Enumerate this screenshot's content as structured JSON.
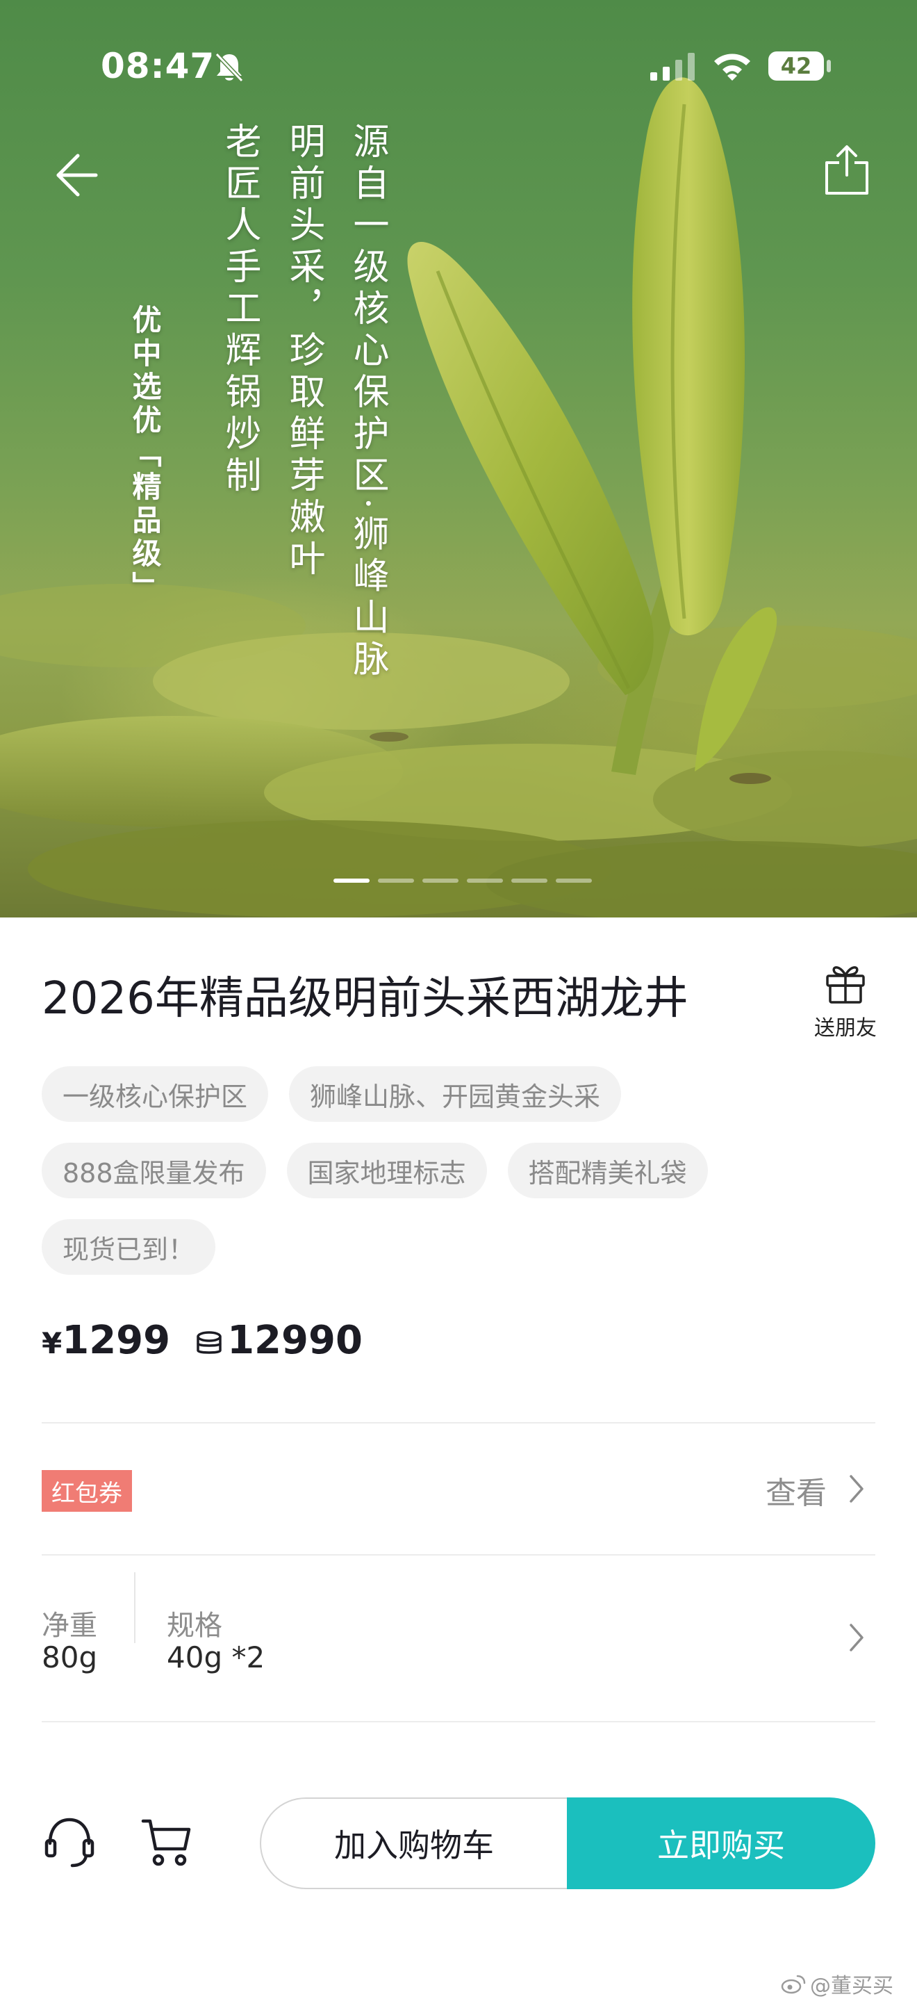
{
  "status_bar": {
    "time": "08:47",
    "battery": "42",
    "icons": [
      "bell-slash-icon",
      "signal-icon",
      "wifi-icon",
      "battery-icon"
    ]
  },
  "hero": {
    "lines": [
      "源自一级核心保护区·狮峰山脉",
      "明前头采，珍取鲜芽嫩叶",
      "老匠人手工辉锅炒制",
      "优中选优「精品级」"
    ],
    "slide_count": 6,
    "active_slide": 1
  },
  "nav": {
    "back_icon": "back-arrow-icon",
    "share_icon": "share-icon"
  },
  "product": {
    "title": "2026年精品级明前头采西湖龙井",
    "gift_label": "送朋友",
    "tag_rows": [
      [
        "一级核心保护区",
        "狮峰山脉、开园黄金头采"
      ],
      [
        "888盒限量发布",
        "国家地理标志",
        "搭配精美礼袋"
      ],
      [
        "现货已到！"
      ]
    ],
    "price_symbol": "¥",
    "price": "1299",
    "coin_price": "12990"
  },
  "coupon": {
    "badge": "红包券",
    "action": "查看"
  },
  "specs": {
    "net_weight_label": "净重",
    "net_weight_value": "80g",
    "spec_label": "规格",
    "spec_value": "40g *2"
  },
  "bottom_bar": {
    "add_to_cart": "加入购物车",
    "buy_now": "立即购买"
  },
  "watermark": "@董买买",
  "colors": {
    "accent": "#1bbfbe",
    "coupon": "#f07c74",
    "tag_bg": "#f2f2f2"
  }
}
